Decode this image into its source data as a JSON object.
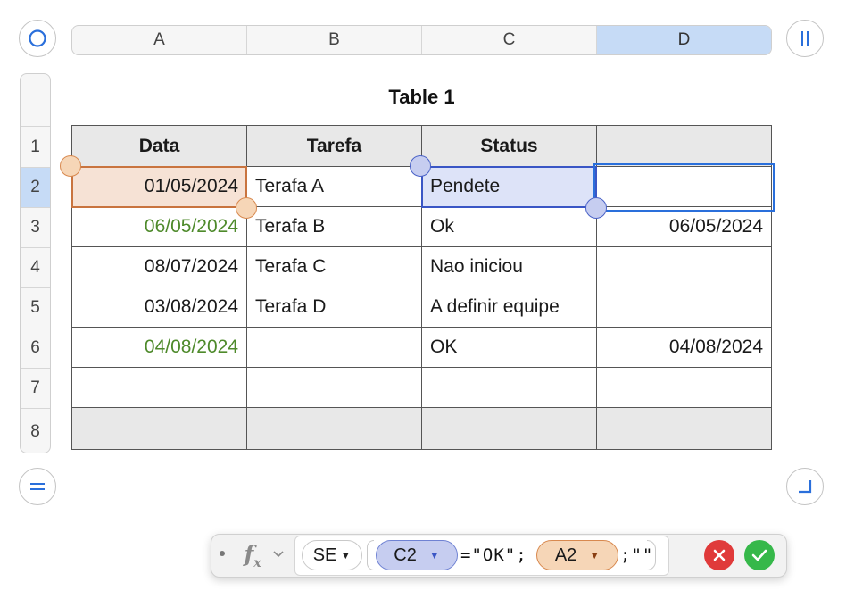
{
  "columns": [
    "A",
    "B",
    "C",
    "D"
  ],
  "rows": [
    "1",
    "2",
    "3",
    "4",
    "5",
    "6",
    "7",
    "8"
  ],
  "table": {
    "title": "Table 1",
    "headers": [
      "Data",
      "Tarefa",
      "Status",
      ""
    ],
    "cells": [
      [
        "01/05/2024",
        "Terafa A",
        "Pendete",
        ""
      ],
      [
        "06/05/2024",
        "Terafa B",
        "Ok",
        "06/05/2024"
      ],
      [
        "08/07/2024",
        "Terafa C",
        "Nao iniciou",
        ""
      ],
      [
        "03/08/2024",
        "Terafa D",
        "A definir equipe",
        ""
      ],
      [
        "04/08/2024",
        "",
        "OK",
        "04/08/2024"
      ],
      [
        "",
        "",
        "",
        ""
      ]
    ]
  },
  "formula": {
    "function": "SE",
    "ref1": "C2",
    "op": "=\"OK\";",
    "ref2": "A2",
    "tail": ";\"\""
  },
  "colors": {
    "selection_blue": "#c6dbf6",
    "date_green": "#4e8a2b",
    "ref_orange": "#f6d6b7",
    "ref_blue": "#c6cdf0",
    "cancel_red": "#e03a3a",
    "accept_green": "#36b84a"
  },
  "icons": {
    "top_left": "circle-select-all-icon",
    "top_right": "column-resize-icon",
    "bottom_left": "row-resize-icon",
    "bottom_right": "corner-resize-icon",
    "fx": "function-icon",
    "cancel": "cancel-x-icon",
    "accept": "accept-check-icon"
  }
}
